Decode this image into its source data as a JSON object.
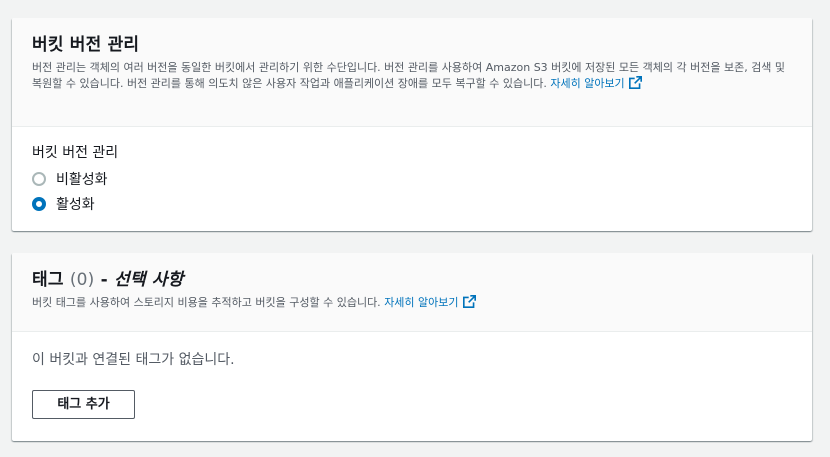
{
  "versioning": {
    "title": "버킷 버전 관리",
    "description": "버전 관리는 객체의 여러 버전을 동일한 버킷에서 관리하기 위한 수단입니다. 버전 관리를 사용하여 Amazon S3 버킷에 저장된 모든 객체의 각 버전을 보존, 검색 및 복원할 수 있습니다. 버전 관리를 통해 의도치 않은 사용자 작업과 애플리케이션 장애를 모두 복구할 수 있습니다.",
    "learn_more": "자세히 알아보기",
    "field_label": "버킷 버전 관리",
    "options": [
      {
        "label": "비활성화",
        "selected": false
      },
      {
        "label": "활성화",
        "selected": true
      }
    ]
  },
  "tags": {
    "title": "태그",
    "count": "(0)",
    "separator": " - ",
    "optional": "선택 사항",
    "description": "버킷 태그를 사용하여 스토리지 비용을 추적하고 버킷을 구성할 수 있습니다.",
    "learn_more": "자세히 알아보기",
    "empty_message": "이 버킷과 연결된 태그가 없습니다.",
    "add_button": "태그 추가"
  },
  "colors": {
    "link": "#0073bb",
    "radio_selected": "#0073bb",
    "page_background": "#f2f3f3"
  },
  "icons": {
    "external_link": "external-link-icon"
  }
}
